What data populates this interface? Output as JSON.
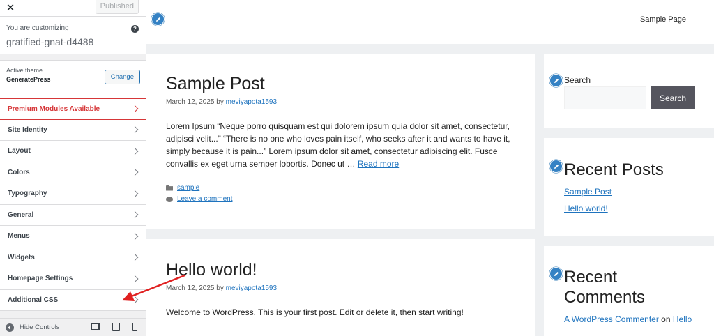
{
  "sidebar": {
    "close_glyph": "✕",
    "published_label": "Published",
    "customizing_label": "You are customizing",
    "site_name": "gratified-gnat-d4488",
    "help_glyph": "?",
    "active_theme_label": "Active theme",
    "theme_name": "GeneratePress",
    "change_label": "Change",
    "items": [
      {
        "label": "Premium Modules Available"
      },
      {
        "label": "Site Identity"
      },
      {
        "label": "Layout"
      },
      {
        "label": "Colors"
      },
      {
        "label": "Typography"
      },
      {
        "label": "General"
      },
      {
        "label": "Menus"
      },
      {
        "label": "Widgets"
      },
      {
        "label": "Homepage Settings"
      },
      {
        "label": "Additional CSS"
      }
    ],
    "hide_controls_label": "Hide Controls"
  },
  "preview": {
    "nav_link": "Sample Page",
    "posts": [
      {
        "title": "Sample Post",
        "date": "March 12, 2025",
        "by": "by",
        "author": "meviyapota1593",
        "excerpt": "Lorem Ipsum “Neque porro quisquam est qui dolorem ipsum quia dolor sit amet, consectetur, adipisci velit...” “There is no one who loves pain itself, who seeks after it and wants to have it, simply because it is pain...” Lorem ipsum dolor sit amet, consectetur adipiscing elit. Fusce convallis ex eget urna semper lobortis. Donec ut …",
        "read_more": "Read more",
        "category": "sample",
        "comment_link": "Leave a comment"
      },
      {
        "title": "Hello world!",
        "date": "March 12, 2025",
        "by": "by",
        "author": "meviyapota1593",
        "excerpt": "Welcome to WordPress. This is your first post. Edit or delete it, then start writing!"
      }
    ],
    "search_widget": {
      "title": "Search",
      "button": "Search"
    },
    "recent_posts": {
      "title": "Recent Posts",
      "items": [
        "Sample Post",
        "Hello world!"
      ]
    },
    "recent_comments": {
      "title_line1": "Recent",
      "title_line2": "Comments",
      "author": "A WordPress Commenter",
      "on": "on",
      "post": "Hello"
    }
  },
  "colors": {
    "premium": "#d63638",
    "link": "#1e73be",
    "edit_pen": "#3582c4",
    "arrow": "#e02020"
  }
}
